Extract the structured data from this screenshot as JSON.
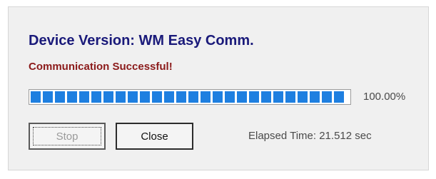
{
  "dialog": {
    "title": "Device Version: WM Easy Comm.",
    "status_message": "Communication Successful!",
    "progress": {
      "percent_text": "100.00%",
      "value": 1.0
    },
    "buttons": {
      "stop_label": "Stop",
      "close_label": "Close"
    },
    "elapsed_text": "Elapsed Time: 21.512 sec"
  },
  "colors": {
    "title": "#1a1a7a",
    "status": "#8b1a1a",
    "progress_fill": "#1e7fe0",
    "dialog_bg": "#f0f0f0"
  }
}
